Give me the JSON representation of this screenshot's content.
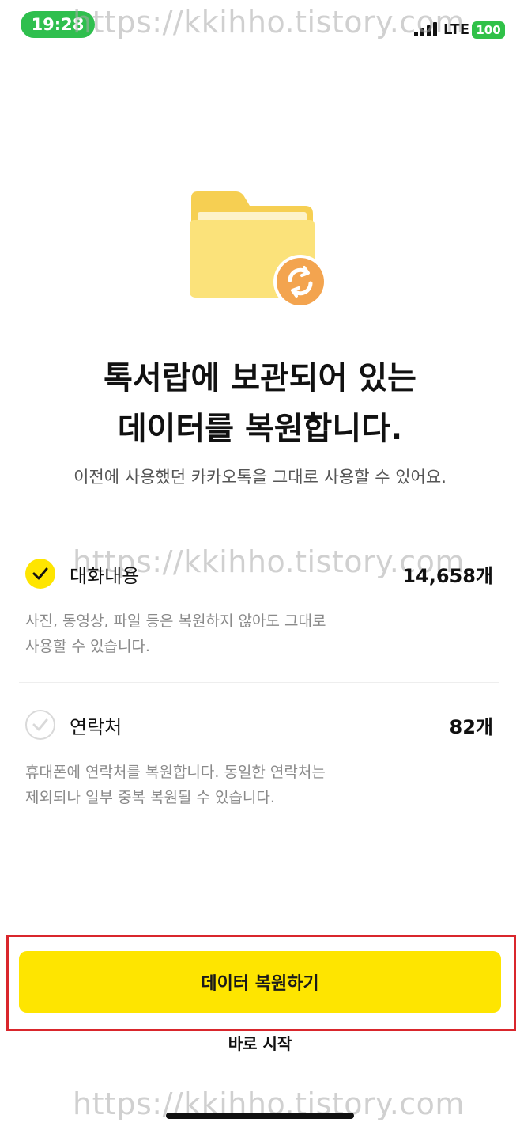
{
  "status_bar": {
    "time": "19:28",
    "network": "LTE",
    "battery": "100"
  },
  "watermark": "https://kkihho.tistory.com",
  "hero": {
    "icon": "folder-sync-icon"
  },
  "title": {
    "line1": "톡서랍에 보관되어 있는",
    "line2": "데이터를 복원합니다."
  },
  "subtitle": "이전에 사용했던 카카오톡을 그대로 사용할 수 있어요.",
  "items": [
    {
      "label": "대화내용",
      "count": "14,658개",
      "checked": true,
      "desc_line1": "사진, 동영상, 파일 등은 복원하지 않아도 그대로",
      "desc_line2": "사용할 수 있습니다."
    },
    {
      "label": "연락처",
      "count": "82개",
      "checked": false,
      "desc_line1": "휴대폰에 연락처를 복원합니다. 동일한 연락처는",
      "desc_line2": "제외되나 일부 중복 복원될 수 있습니다."
    }
  ],
  "primary_button": "데이터 복원하기",
  "secondary_link": "바로 시작",
  "colors": {
    "accent": "#fee500",
    "highlight_box": "#d9262c",
    "status_pill": "#2fbf4e",
    "folder": "#fbe27a",
    "sync_badge": "#f3a44f"
  }
}
